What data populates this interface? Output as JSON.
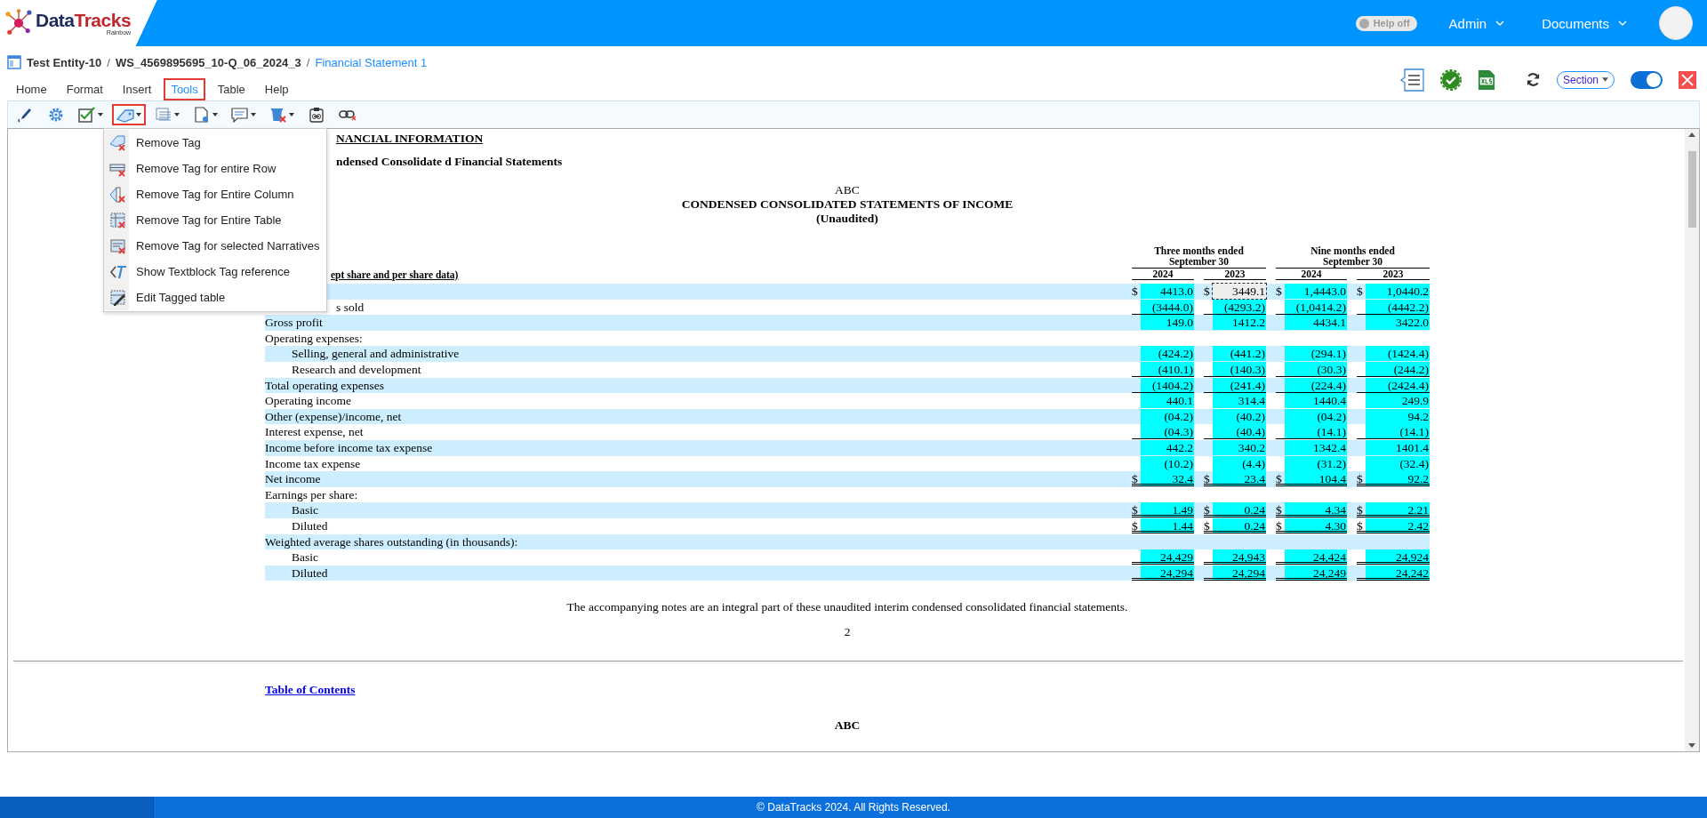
{
  "header": {
    "logo": {
      "parts": [
        "Data",
        "Tracks"
      ],
      "tagline": "Rainbow"
    },
    "help_toggle": {
      "label": "Help off",
      "on": false
    },
    "menus": [
      "Admin",
      "Documents"
    ]
  },
  "breadcrumb": [
    {
      "label": "Test Entity-10",
      "kind": "link"
    },
    {
      "label": "/",
      "kind": "sep"
    },
    {
      "label": "WS_4569895695_10-Q_06_2024_3",
      "kind": "link"
    },
    {
      "label": "/",
      "kind": "sep"
    },
    {
      "label": "Financial Statement 1",
      "kind": "current"
    }
  ],
  "ribbon_tabs": [
    {
      "label": "Home",
      "selected": false
    },
    {
      "label": "Format",
      "selected": false
    },
    {
      "label": "Insert",
      "selected": false
    },
    {
      "label": "Tools",
      "selected": true
    },
    {
      "label": "Table",
      "selected": false
    },
    {
      "label": "Help",
      "selected": false
    }
  ],
  "actions": {
    "section_dropdown": "Section",
    "view_toggle": {
      "on": true
    }
  },
  "toolbar": [
    {
      "kind": "pen",
      "selected": false
    },
    {
      "kind": "gear",
      "selected": false
    },
    {
      "kind": "check",
      "selected": false
    },
    {
      "kind": "tag",
      "selected": true
    },
    {
      "kind": "list",
      "selected": false
    },
    {
      "kind": "page",
      "selected": false
    },
    {
      "kind": "comment",
      "selected": false
    },
    {
      "kind": "delete",
      "selected": false
    },
    {
      "kind": "clip",
      "selected": false
    },
    {
      "kind": "unlink",
      "selected": false
    }
  ],
  "tools_menu": [
    {
      "label": "Remove Tag",
      "kind": "tag"
    },
    {
      "label": "Remove Tag for entire Row",
      "kind": "row"
    },
    {
      "label": "Remove Tag for Entire Column",
      "kind": "column"
    },
    {
      "label": "Remove Tag for Entire Table",
      "kind": "table"
    },
    {
      "label": "Remove Tag for selected Narratives",
      "kind": "narrative"
    },
    {
      "label": "Show Textblock Tag reference",
      "kind": "textblock"
    },
    {
      "label": "Edit Tagged table",
      "kind": "edit"
    }
  ],
  "document": {
    "section_heading": "NANCIAL INFORMATION",
    "subheading": "ndensed Consolidate d Financial Statements",
    "company": "ABC",
    "title": "CONDENSED CONSOLIDATED STATEMENTS OF INCOME",
    "subtitle": "(Unaudited)",
    "unit_note": "ept share and per share data)",
    "groups": [
      {
        "label": "Three months ended",
        "sublabel": "September 30",
        "years": [
          "2024",
          "2023"
        ]
      },
      {
        "label": "Nine months ended",
        "sublabel": "September 30",
        "years": [
          "2024",
          "2023"
        ]
      }
    ],
    "rows": [
      {
        "kind": "line",
        "single_rule": false,
        "double_rule": false,
        "cells": [
          {
            "currency": "$",
            "value": "4413.0",
            "selected": false
          },
          {
            "currency": "$",
            "value": "3449.1",
            "selected": true
          },
          {
            "currency": "$",
            "value": "1,4443.0",
            "selected": false
          },
          {
            "currency": "$",
            "value": "1,0440.2",
            "selected": false
          }
        ]
      },
      {
        "kind": "clipped",
        "label": "s sold",
        "single_rule": true,
        "double_rule": false,
        "cells": [
          {
            "value": "(3444.0)",
            "selected": false
          },
          {
            "value": "(4293.2)",
            "selected": false
          },
          {
            "value": "(1,0414.2)",
            "selected": false
          },
          {
            "value": "(4442.2)",
            "selected": false
          }
        ]
      },
      {
        "kind": "line",
        "label": "Gross profit",
        "single_rule": false,
        "double_rule": false,
        "cells": [
          {
            "value": "149.0",
            "selected": false
          },
          {
            "value": "1412.2",
            "selected": false
          },
          {
            "value": "4434.1",
            "selected": false
          },
          {
            "value": "3422.0",
            "selected": false
          }
        ]
      },
      {
        "kind": "line",
        "label": "Operating expenses:"
      },
      {
        "kind": "sub",
        "label": "Selling, general and administrative",
        "single_rule": false,
        "double_rule": false,
        "cells": [
          {
            "value": "(424.2)",
            "selected": false
          },
          {
            "value": "(441.2)",
            "selected": false
          },
          {
            "value": "(294.1)",
            "selected": false
          },
          {
            "value": "(1424.4)",
            "selected": false
          }
        ]
      },
      {
        "kind": "sub",
        "label": "Research and development",
        "single_rule": true,
        "double_rule": false,
        "cells": [
          {
            "value": "(410.1)",
            "selected": false
          },
          {
            "value": "(140.3)",
            "selected": false
          },
          {
            "value": "(30.3)",
            "selected": false
          },
          {
            "value": "(244.2)",
            "selected": false
          }
        ]
      },
      {
        "kind": "line",
        "label": "Total operating expenses",
        "single_rule": true,
        "double_rule": false,
        "cells": [
          {
            "value": "(1404.2)",
            "selected": false
          },
          {
            "value": "(241.4)",
            "selected": false
          },
          {
            "value": "(224.4)",
            "selected": false
          },
          {
            "value": "(2424.4)",
            "selected": false
          }
        ]
      },
      {
        "kind": "line",
        "label": "Operating income",
        "single_rule": false,
        "double_rule": false,
        "cells": [
          {
            "value": "440.1",
            "selected": false
          },
          {
            "value": "314.4",
            "selected": false
          },
          {
            "value": "1440.4",
            "selected": false
          },
          {
            "value": "249.9",
            "selected": false
          }
        ]
      },
      {
        "kind": "line",
        "label": "Other (expense)/income, net",
        "single_rule": false,
        "double_rule": false,
        "cells": [
          {
            "value": "(04.2)",
            "selected": false
          },
          {
            "value": "(40.2)",
            "selected": false
          },
          {
            "value": "(04.2)",
            "selected": false
          },
          {
            "value": "94.2",
            "selected": false
          }
        ]
      },
      {
        "kind": "line",
        "label": "Interest expense, net",
        "single_rule": true,
        "double_rule": false,
        "cells": [
          {
            "value": "(04.3)",
            "selected": false
          },
          {
            "value": "(40.4)",
            "selected": false
          },
          {
            "value": "(14.1)",
            "selected": false
          },
          {
            "value": "(14.1)",
            "selected": false
          }
        ]
      },
      {
        "kind": "line",
        "label": "Income before income tax expense",
        "single_rule": false,
        "double_rule": false,
        "cells": [
          {
            "value": "442.2",
            "selected": false
          },
          {
            "value": "340.2",
            "selected": false
          },
          {
            "value": "1342.4",
            "selected": false
          },
          {
            "value": "1401.4",
            "selected": false
          }
        ]
      },
      {
        "kind": "line",
        "label": "Income tax expense",
        "single_rule": false,
        "double_rule": false,
        "cells": [
          {
            "value": "(10.2)",
            "selected": false
          },
          {
            "value": "(4.4)",
            "selected": false
          },
          {
            "value": "(31.2)",
            "selected": false
          },
          {
            "value": "(32.4)",
            "selected": false
          }
        ]
      },
      {
        "kind": "line",
        "label": "Net income",
        "single_rule": false,
        "double_rule": true,
        "cells": [
          {
            "currency": "$",
            "value": "32.4",
            "selected": false
          },
          {
            "currency": "$",
            "value": "23.4",
            "selected": false
          },
          {
            "currency": "$",
            "value": "104.4",
            "selected": false
          },
          {
            "currency": "$",
            "value": "92.2",
            "selected": false
          }
        ]
      },
      {
        "kind": "line",
        "label": "Earnings per share:"
      },
      {
        "kind": "sub",
        "label": "Basic",
        "single_rule": false,
        "double_rule": true,
        "cells": [
          {
            "currency": "$",
            "value": "1.49",
            "selected": false
          },
          {
            "currency": "$",
            "value": "0.24",
            "selected": false
          },
          {
            "currency": "$",
            "value": "4.34",
            "selected": false
          },
          {
            "currency": "$",
            "value": "2.21",
            "selected": false
          }
        ]
      },
      {
        "kind": "sub",
        "label": "Diluted",
        "single_rule": false,
        "double_rule": true,
        "cells": [
          {
            "currency": "$",
            "value": "1.44",
            "selected": false
          },
          {
            "currency": "$",
            "value": "0.24",
            "selected": false
          },
          {
            "currency": "$",
            "value": "4.30",
            "selected": false
          },
          {
            "currency": "$",
            "value": "2.42",
            "selected": false
          }
        ]
      },
      {
        "kind": "line",
        "label": "Weighted average shares outstanding (in thousands):"
      },
      {
        "kind": "sub",
        "label": "Basic",
        "single_rule": false,
        "double_rule": true,
        "cells": [
          {
            "value": "24,429",
            "selected": false
          },
          {
            "value": "24,943",
            "selected": false
          },
          {
            "value": "24,424",
            "selected": false
          },
          {
            "value": "24,924",
            "selected": false
          }
        ]
      },
      {
        "kind": "sub",
        "label": "Diluted",
        "single_rule": false,
        "double_rule": true,
        "cells": [
          {
            "value": "24,294",
            "selected": false
          },
          {
            "value": "24,294",
            "selected": false
          },
          {
            "value": "24,249",
            "selected": false
          },
          {
            "value": "24,242",
            "selected": false
          }
        ]
      }
    ],
    "note": "The accompanying notes are an integral part of these unaudited interim condensed consolidated financial statements.",
    "page_number": "2",
    "toc_link": "Table of Contents",
    "next_company": "ABC"
  },
  "footer": "© DataTracks 2024. All Rights Reserved."
}
